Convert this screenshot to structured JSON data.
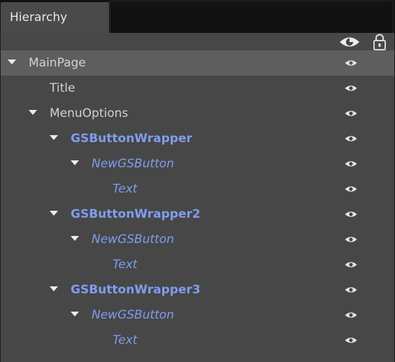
{
  "window": {
    "tab_title": "Hierarchy"
  },
  "header": {
    "visibility_icon": "eye-icon",
    "lock_icon": "lock-icon"
  },
  "colors": {
    "panel_bg": "#474747",
    "selected_row_bg": "#5e5e5e",
    "object_text": "#d2d2d2",
    "prefab_text": "#7f9df0",
    "tab_bg": "#4a4a4a",
    "tabbar_bg": "#121212"
  },
  "tree": [
    {
      "label": "MainPage",
      "depth": 0,
      "expanded": true,
      "has_children": true,
      "style": "plain",
      "selected": true
    },
    {
      "label": "Title",
      "depth": 1,
      "expanded": false,
      "has_children": false,
      "style": "plain",
      "selected": false
    },
    {
      "label": "MenuOptions",
      "depth": 1,
      "expanded": true,
      "has_children": true,
      "style": "plain",
      "selected": false
    },
    {
      "label": "GSButtonWrapper",
      "depth": 2,
      "expanded": true,
      "has_children": true,
      "style": "bold",
      "selected": false
    },
    {
      "label": "NewGSButton",
      "depth": 3,
      "expanded": true,
      "has_children": true,
      "style": "italic",
      "selected": false
    },
    {
      "label": "Text",
      "depth": 4,
      "expanded": false,
      "has_children": false,
      "style": "italic",
      "selected": false
    },
    {
      "label": "GSButtonWrapper2",
      "depth": 2,
      "expanded": true,
      "has_children": true,
      "style": "bold",
      "selected": false
    },
    {
      "label": "NewGSButton",
      "depth": 3,
      "expanded": true,
      "has_children": true,
      "style": "italic",
      "selected": false
    },
    {
      "label": "Text",
      "depth": 4,
      "expanded": false,
      "has_children": false,
      "style": "italic",
      "selected": false
    },
    {
      "label": "GSButtonWrapper3",
      "depth": 2,
      "expanded": true,
      "has_children": true,
      "style": "bold",
      "selected": false
    },
    {
      "label": "NewGSButton",
      "depth": 3,
      "expanded": true,
      "has_children": true,
      "style": "italic",
      "selected": false
    },
    {
      "label": "Text",
      "depth": 4,
      "expanded": false,
      "has_children": false,
      "style": "italic",
      "selected": false
    }
  ]
}
